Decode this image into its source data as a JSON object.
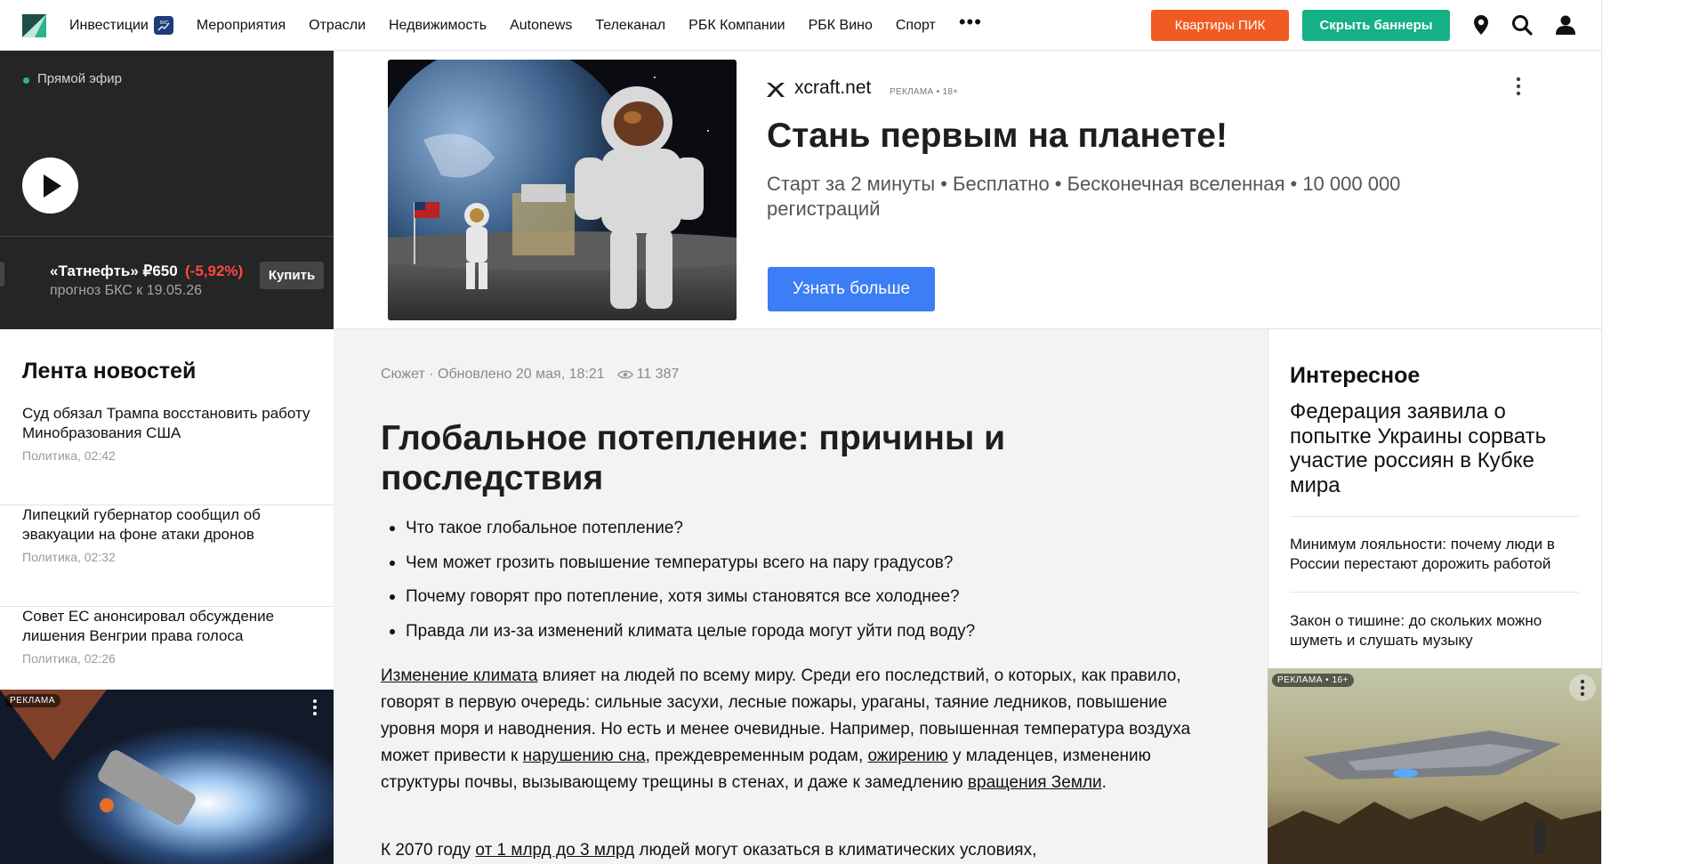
{
  "header": {
    "nav": [
      {
        "label": "Инвестиции"
      },
      {
        "label": "Мероприятия"
      },
      {
        "label": "Отрасли"
      },
      {
        "label": "Недвижимость"
      },
      {
        "label": "Autonews"
      },
      {
        "label": "Телеканал"
      },
      {
        "label": "РБК Компании"
      },
      {
        "label": "РБК Вино"
      },
      {
        "label": "Спорт"
      }
    ],
    "more_label": "•••",
    "badge_icon": "bcs-badge-icon",
    "pik_button": "Квартиры ПИК",
    "hide_banners_button": "Скрыть баннеры",
    "icons": [
      "location-pin-icon",
      "search-icon",
      "user-icon"
    ],
    "colors": {
      "pik": "#f15a22",
      "hide": "#15b085"
    }
  },
  "live": {
    "label": "Прямой эфир",
    "ticker_name": "«Татнефть» ₽650",
    "ticker_change": "(-5,92%)",
    "ticker_sub": "прогноз БКС к 19.05.26",
    "buy_label": "Купить",
    "change_color": "#ff4747"
  },
  "top_ad": {
    "domain": "xcraft.net",
    "tag": "РЕКЛАМА • 18+",
    "title": "Стань первым на планете!",
    "description": "Старт за 2 минуты • Бесплатно • Бесконечная вселенная • 10 000 000 регистраций",
    "cta": "Узнать больше",
    "cta_color": "#3b7ef6"
  },
  "newsfeed": {
    "title": "Лента новостей",
    "items": [
      {
        "headline": "Суд обязал Трампа восстановить работу Минобразования США",
        "meta": "Политика, 02:42"
      },
      {
        "headline": "Липецкий губернатор сообщил об эвакуации на фоне атаки дронов",
        "meta": "Политика, 02:32"
      },
      {
        "headline": "Совет ЕС анонсировал обсуждение лишения Венгрии права голоса",
        "meta": "Политика, 02:26"
      }
    ],
    "ad_tag": "РЕКЛАМА"
  },
  "article": {
    "meta": "Сюжет · Обновлено 20 мая, 18:21",
    "views": "11 387",
    "title": "Глобальное потепление: причины и последствия",
    "bullets": [
      "Что такое глобальное потепление?",
      "Чем может грозить повышение температуры всего на пару градусов?",
      "Почему говорят про потепление, хотя зимы становятся все холоднее?",
      "Правда ли из-за изменений климата целые города могут уйти под воду?"
    ],
    "p1": {
      "link1": "Изменение климата",
      "t1": " влияет на людей по всему миру. Среди его последствий, о которых, как правило, говорят в первую очередь: сильные засухи, лесные пожары, ураганы, таяние ледников, повышение уровня моря и наводнения. Но есть и менее очевидные. Например, повышенная температура воздуха может привести к ",
      "link2": "нарушению сна",
      "t2": ", преждевременным родам, ",
      "link3": "ожирению",
      "t3": " у младенцев, изменению структуры почвы, вызывающему трещины в стенах, и даже к замедлению ",
      "link4": "вращения Земли",
      "t4": "."
    },
    "p2": {
      "t1": "К 2070 году ",
      "link1": "от 1 млрд до 3 млрд",
      "t2": " людей могут оказаться в климатических условиях,"
    }
  },
  "interesting": {
    "title": "Интересное",
    "lead": "Федерация заявила о попытке Украины сорвать участие россиян в Кубке мира",
    "items": [
      "Минимум лояльности: почему люди в России перестают дорожить работой",
      "Закон о тишине: до скольких можно шуметь и слушать музыку"
    ],
    "ad_tag": "РЕКЛАМА • 16+"
  }
}
